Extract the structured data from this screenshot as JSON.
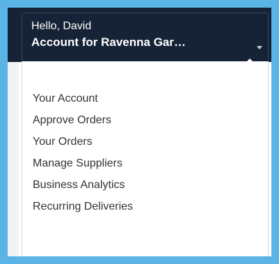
{
  "account": {
    "greeting": "Hello, David",
    "account_label": "Account for Ravenna Gar…",
    "caret_icon": "caret-down-icon"
  },
  "menu": {
    "items": [
      {
        "label": "Your Account"
      },
      {
        "label": "Approve Orders"
      },
      {
        "label": "Your Orders"
      },
      {
        "label": "Manage Suppliers"
      },
      {
        "label": "Business Analytics"
      },
      {
        "label": "Recurring Deliveries"
      }
    ]
  },
  "colors": {
    "header_bg": "#162235",
    "highlight_border": "#5ab4e5",
    "menu_text": "#333333"
  }
}
